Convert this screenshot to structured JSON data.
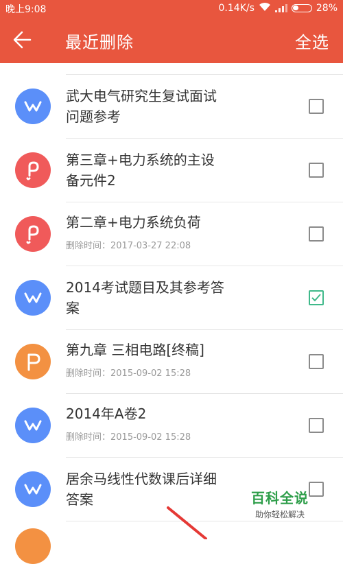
{
  "status_bar": {
    "time": "晚上9:08",
    "speed": "0.14K/s",
    "battery": "28%"
  },
  "header": {
    "title": "最近删除",
    "select_all": "全选"
  },
  "items": [
    {
      "name_line1": "武大电气研究生复试面试",
      "name_line2": "问题参考",
      "time": "",
      "icon": "word-icon",
      "color": "#5b8ff9",
      "checked": false
    },
    {
      "name_line1": "第三章+电力系统的主设",
      "name_line2": "备元件2",
      "time": "",
      "icon": "pdf-icon",
      "color": "#f05a5a",
      "checked": false
    },
    {
      "name_line1": "第二章+电力系统负荷",
      "name_line2": "",
      "time": "删除时间：2017-03-27   22:08",
      "icon": "pdf-icon",
      "color": "#f05a5a",
      "checked": false
    },
    {
      "name_line1": "2014考试题目及其参考答",
      "name_line2": "案",
      "time": "",
      "icon": "word-icon",
      "color": "#5b8ff9",
      "checked": true
    },
    {
      "name_line1": "第九章 三相电路[终稿]",
      "name_line2": "",
      "time": "删除时间：2015-09-02   15:28",
      "icon": "ppt-icon",
      "color": "#f39142",
      "checked": false
    },
    {
      "name_line1": "2014年A卷2",
      "name_line2": "",
      "time": "删除时间：2015-09-02   15:28",
      "icon": "word-icon",
      "color": "#5b8ff9",
      "checked": false
    },
    {
      "name_line1": "居余马线性代数课后详细",
      "name_line2": "答案",
      "time": "",
      "icon": "word-icon",
      "color": "#5b8ff9",
      "checked": false
    }
  ],
  "watermark": {
    "title": "百科全说",
    "subtitle": "助你轻松解决"
  }
}
